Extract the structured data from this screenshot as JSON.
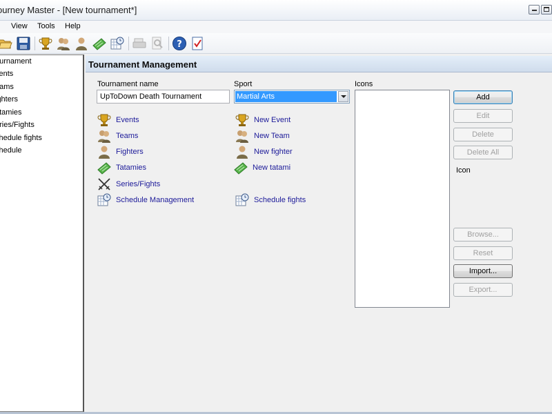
{
  "window": {
    "title": "ourney Master - [New tournament*]"
  },
  "menu": {
    "items": [
      "View",
      "Tools",
      "Help"
    ]
  },
  "toolbar": {
    "buttons": [
      "open-icon",
      "save-icon",
      "trophy-icon",
      "team-icon",
      "fighter-icon",
      "tatami-icon",
      "schedule-icon",
      "print-icon",
      "print-preview-icon",
      "help-icon",
      "checklist-icon"
    ]
  },
  "tree": {
    "items": [
      "ournament",
      "vents",
      "eams",
      "ighters",
      "atamies",
      "eries/Fights",
      "chedule fights",
      "chedule"
    ]
  },
  "header": {
    "title": "Tournament Management"
  },
  "form": {
    "tournament_name_label": "Tournament name",
    "tournament_name_value": "UpToDown Death Tournament",
    "sport_label": "Sport",
    "sport_value": "Martial Arts",
    "icons_label": "Icons",
    "icon_caption": "Icon"
  },
  "links": {
    "events": "Events",
    "teams": "Teams",
    "fighters": "Fighters",
    "tatamies": "Tatamies",
    "series_fights": "Series/Fights",
    "schedule_management": "Schedule Management",
    "new_event": "New Event",
    "new_team": "New Team",
    "new_fighter": "New fighter",
    "new_tatami": "New tatami",
    "schedule_fights": "Schedule fights"
  },
  "buttons": {
    "add": "Add",
    "edit": "Edit",
    "delete": "Delete",
    "delete_all": "Delete All",
    "browse": "Browse...",
    "reset": "Reset",
    "import": "Import...",
    "export": "Export..."
  },
  "colors": {
    "link": "#1c1a99",
    "selection": "#3399ff",
    "header_bg": "#d8e4f2"
  }
}
